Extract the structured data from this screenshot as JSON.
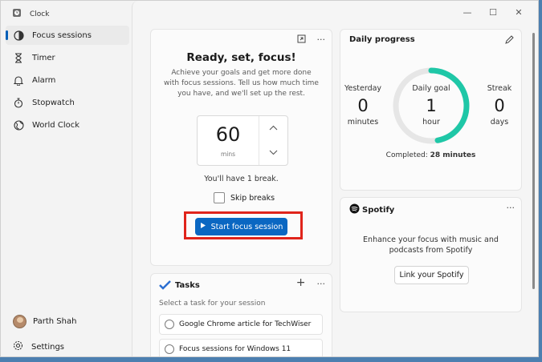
{
  "app": {
    "title": "Clock"
  },
  "window_controls": {
    "minimize": "—",
    "maximize": "☐",
    "close": "✕"
  },
  "sidebar": {
    "items": [
      {
        "label": "Focus sessions",
        "icon": "focus-icon",
        "active": true
      },
      {
        "label": "Timer",
        "icon": "hourglass-icon"
      },
      {
        "label": "Alarm",
        "icon": "bell-icon"
      },
      {
        "label": "Stopwatch",
        "icon": "stopwatch-icon"
      },
      {
        "label": "World Clock",
        "icon": "globe-icon"
      }
    ],
    "user": {
      "name": "Parth Shah"
    },
    "settings_label": "Settings"
  },
  "focus": {
    "title": "Ready, set, focus!",
    "description": "Achieve your goals and get more done with focus sessions. Tell us how much time you have, and we'll set up the rest.",
    "minutes": "60",
    "unit": "mins",
    "break_text": "You'll have 1 break.",
    "skip_label": "Skip breaks",
    "start_label": "Start focus session"
  },
  "tasks": {
    "title": "Tasks",
    "subtitle": "Select a task for your session",
    "add": "+",
    "more": "···",
    "items": [
      "Google Chrome article for TechWiser",
      "Focus sessions for Windows 11"
    ]
  },
  "daily": {
    "title": "Daily progress",
    "yesterday": {
      "label": "Yesterday",
      "value": "0",
      "unit": "minutes"
    },
    "goal": {
      "label": "Daily goal",
      "value": "1",
      "unit": "hour",
      "progress": 0.47
    },
    "streak": {
      "label": "Streak",
      "value": "0",
      "unit": "days"
    },
    "completed_prefix": "Completed: ",
    "completed_value": "28 minutes"
  },
  "spotify": {
    "brand": "Spotify",
    "text": "Enhance your focus with music and podcasts from Spotify",
    "link_label": "Link your Spotify",
    "more": "···"
  },
  "colors": {
    "accent": "#0a67c2",
    "ring": "#1fc7a7",
    "highlight": "#e0241b"
  }
}
